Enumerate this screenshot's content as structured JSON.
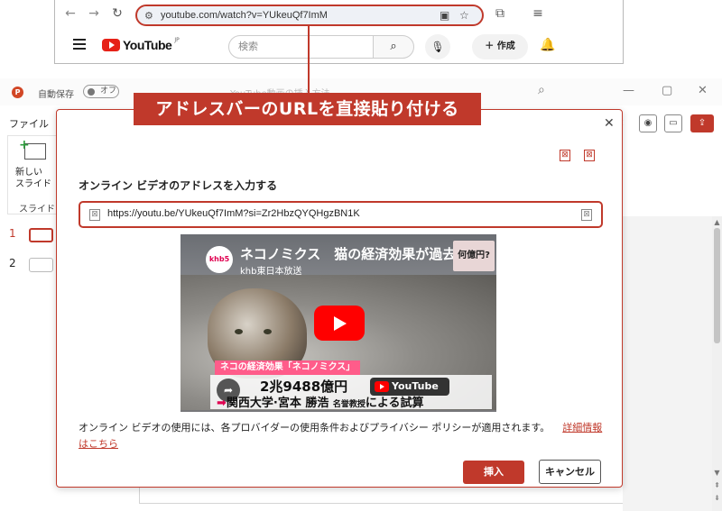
{
  "browser": {
    "url": "youtube.com/watch?v=YUkeuQf7ImM",
    "youtube_logo": "YouTube",
    "youtube_region": "JP",
    "search_placeholder": "検索",
    "create_label": "作成"
  },
  "ppt": {
    "autosave_label": "自動保存",
    "autosave_state": "オフ",
    "title_partial": "YouTube動画の挿入方法...",
    "menu_file": "ファイル",
    "menu_t": "t",
    "new_slide": "新しい\nスライド",
    "ribbon_group": "スライド",
    "thumbs": [
      {
        "num": "1"
      },
      {
        "num": "2"
      }
    ]
  },
  "callout": {
    "text": "アドレスバーのURLを直接貼り付ける"
  },
  "dialog": {
    "label": "オンライン ビデオのアドレスを入力する",
    "url_value": "https://youtu.be/YUkeuQf7ImM?si=Zr2HbzQYQHgzBN1K",
    "video": {
      "channel_badge": "khb5",
      "title": "ネコノミクス　猫の経済効果が過去",
      "subtitle": "khb東日本放送",
      "corner_badge": "何億円?",
      "caption": "ネコの経済効果「ネコノミクス」",
      "amount": "2兆9488億円",
      "watermark": "YouTube",
      "source": "関西大学·宮本 勝浩",
      "source_role": "名誉教授",
      "source_suffix": "による試算"
    },
    "notice": "オンライン ビデオの使用には、各プロバイダーの使用条件およびプライバシー ポリシーが適用されます。",
    "notice_link": "詳細情報はこちら",
    "insert_label": "挿入",
    "cancel_label": "キャンセル"
  },
  "colors": {
    "accent": "#c0392b",
    "youtube_red": "#ff0000"
  }
}
